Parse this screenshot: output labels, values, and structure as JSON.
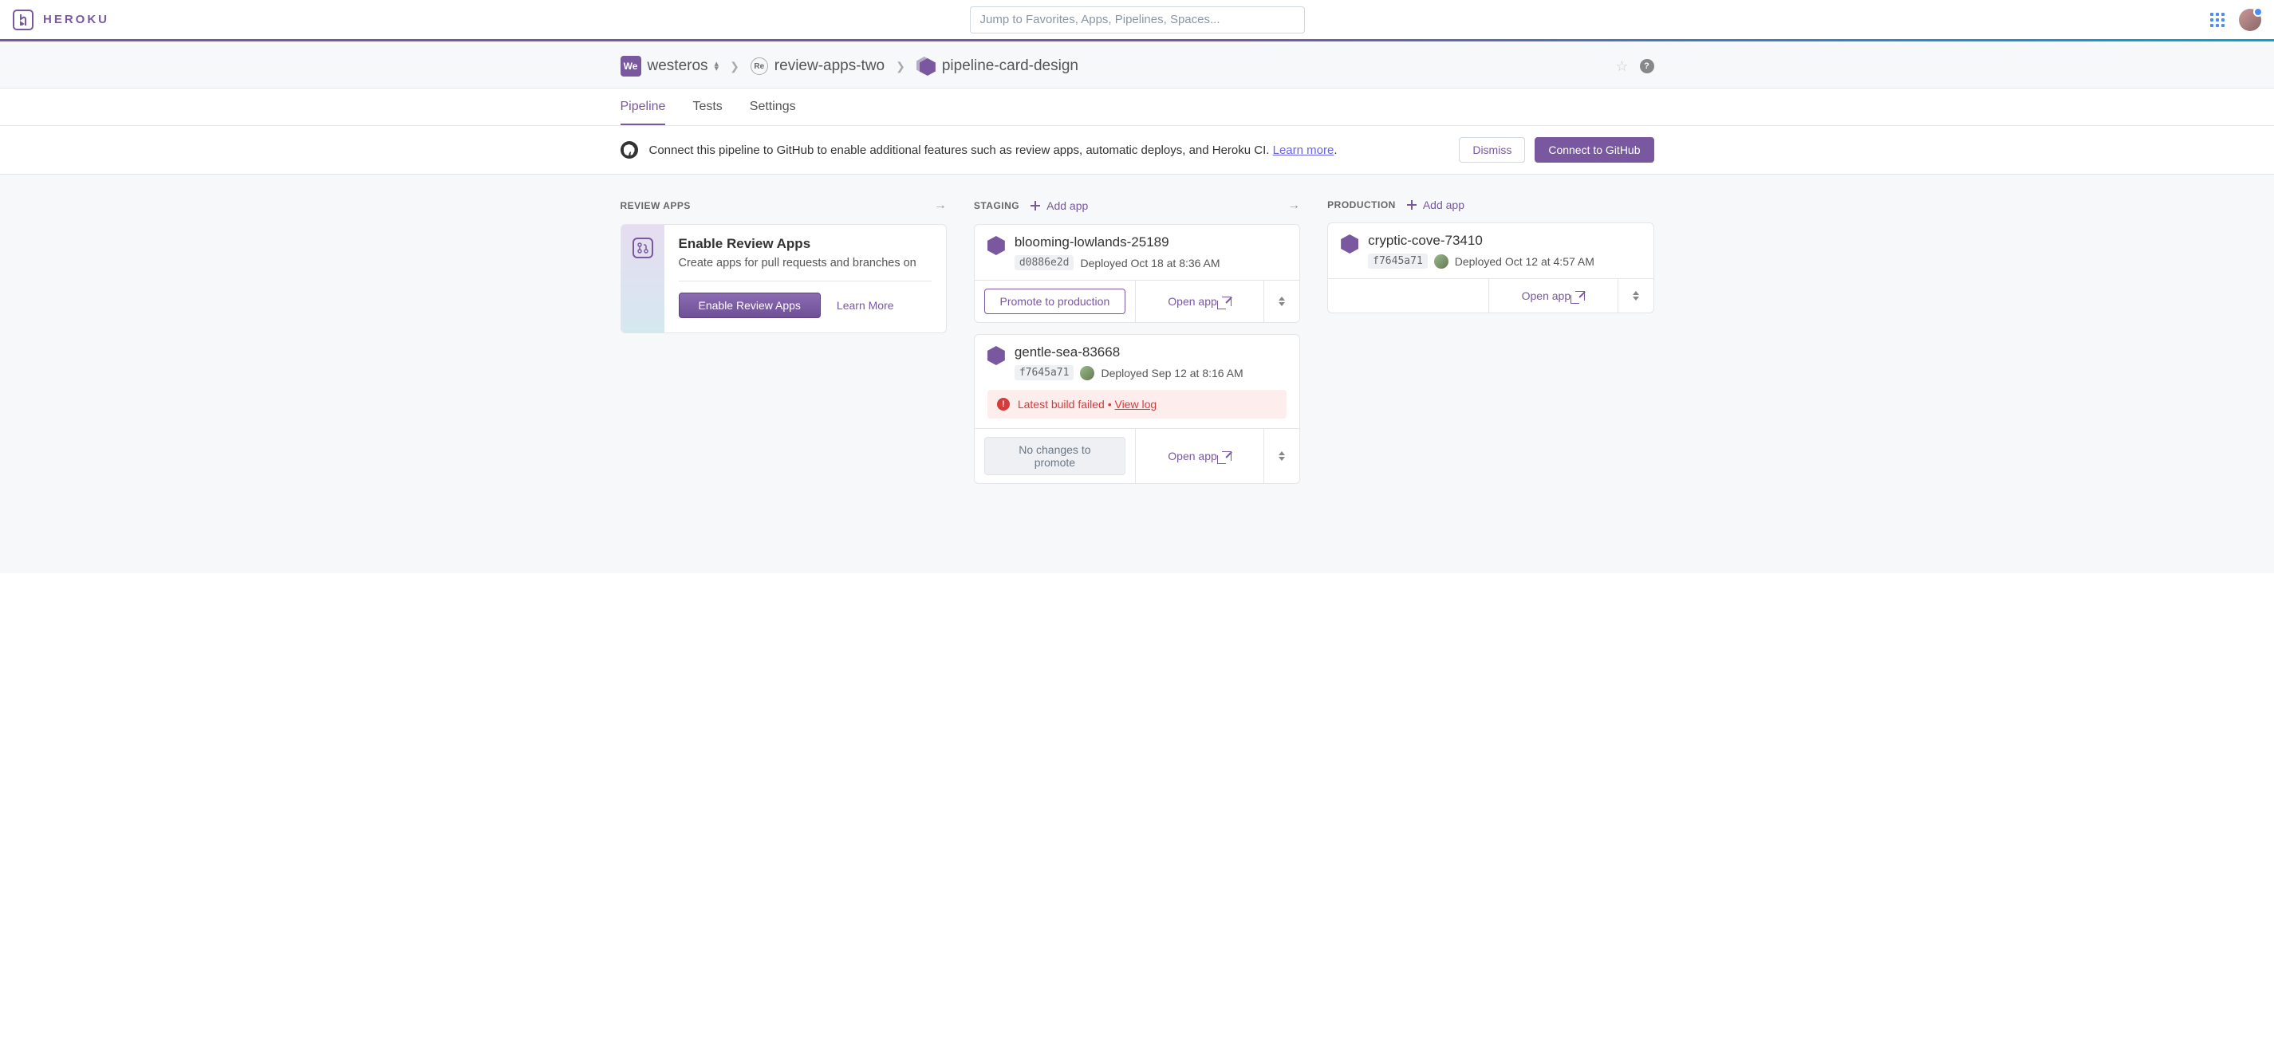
{
  "brand": "HEROKU",
  "search": {
    "placeholder": "Jump to Favorites, Apps, Pipelines, Spaces..."
  },
  "breadcrumb": {
    "team": {
      "badge": "We",
      "name": "westeros"
    },
    "space": {
      "badge": "Re",
      "name": "review-apps-two"
    },
    "pipeline": {
      "name": "pipeline-card-design"
    }
  },
  "tabs": [
    {
      "label": "Pipeline",
      "active": true
    },
    {
      "label": "Tests",
      "active": false
    },
    {
      "label": "Settings",
      "active": false
    }
  ],
  "banner": {
    "text": "Connect this pipeline to GitHub to enable additional features such as review apps, automatic deploys, and Heroku CI. ",
    "learn_more": "Learn more",
    "dismiss": "Dismiss",
    "connect": "Connect to GitHub"
  },
  "columns": {
    "review": {
      "title": "REVIEW APPS",
      "card": {
        "title": "Enable Review Apps",
        "desc": "Create apps for pull requests and branches on",
        "enable_btn": "Enable Review Apps",
        "learn_more": "Learn More"
      }
    },
    "staging": {
      "title": "STAGING",
      "add_label": "Add app",
      "apps": [
        {
          "name": "blooming-lowlands-25189",
          "commit": "d0886e2d",
          "deployed": "Deployed Oct 18 at 8:36 AM",
          "show_avatar": false,
          "primary_btn": "Promote to production",
          "primary_style": "outline",
          "open": "Open app",
          "error": null
        },
        {
          "name": "gentle-sea-83668",
          "commit": "f7645a71",
          "deployed": "Deployed Sep 12 at 8:16 AM",
          "show_avatar": true,
          "primary_btn": "No changes to promote",
          "primary_style": "disabled",
          "open": "Open app",
          "error": {
            "text": "Latest build failed",
            "link": "View log"
          }
        }
      ]
    },
    "production": {
      "title": "PRODUCTION",
      "add_label": "Add app",
      "apps": [
        {
          "name": "cryptic-cove-73410",
          "commit": "f7645a71",
          "deployed": "Deployed Oct 12 at 4:57 AM",
          "show_avatar": true,
          "open": "Open app"
        }
      ]
    }
  }
}
